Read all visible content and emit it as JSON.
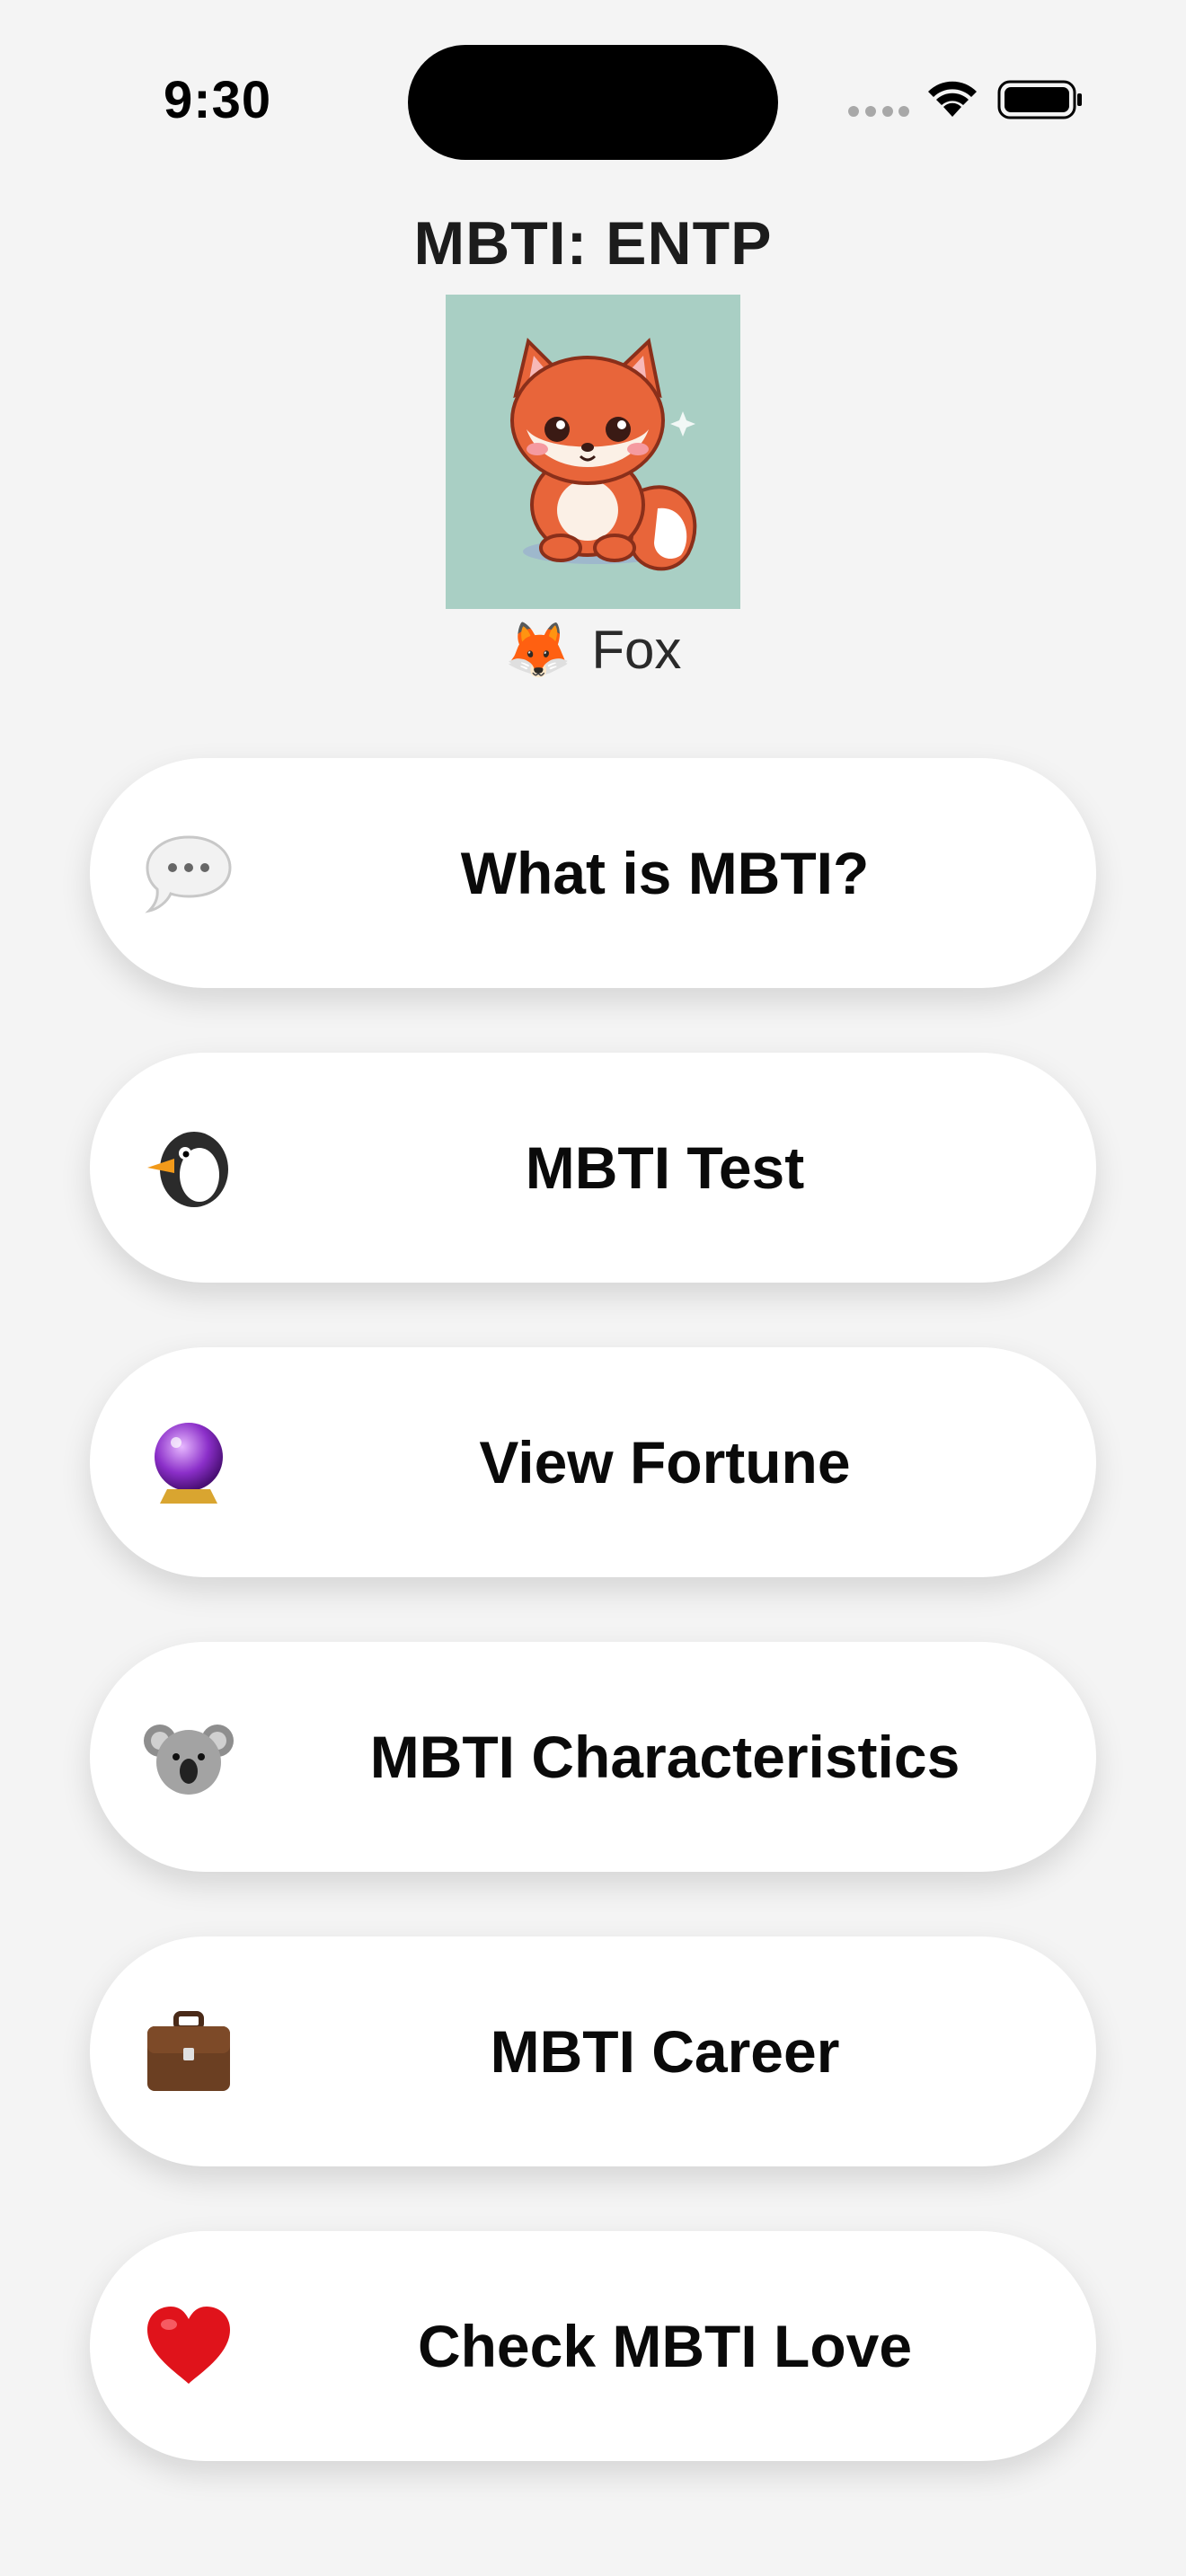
{
  "status_bar": {
    "time": "9:30"
  },
  "header": {
    "title": "MBTI: ENTP",
    "animal_emoji": "🦊",
    "animal_name": "Fox",
    "avatar_icon": "fox-illustration"
  },
  "menu": {
    "items": [
      {
        "label": "What is MBTI?",
        "icon": "speech-bubble-icon"
      },
      {
        "label": "MBTI Test",
        "icon": "penguin-icon"
      },
      {
        "label": "View Fortune",
        "icon": "crystal-ball-icon"
      },
      {
        "label": "MBTI Characteristics",
        "icon": "koala-icon"
      },
      {
        "label": "MBTI Career",
        "icon": "briefcase-icon"
      },
      {
        "label": "Check MBTI Love",
        "icon": "heart-icon"
      }
    ]
  },
  "colors": {
    "background": "#f4f4f4",
    "button_background": "#ffffff",
    "avatar_background": "#a9cfc4",
    "fox_orange": "#e8653a"
  }
}
